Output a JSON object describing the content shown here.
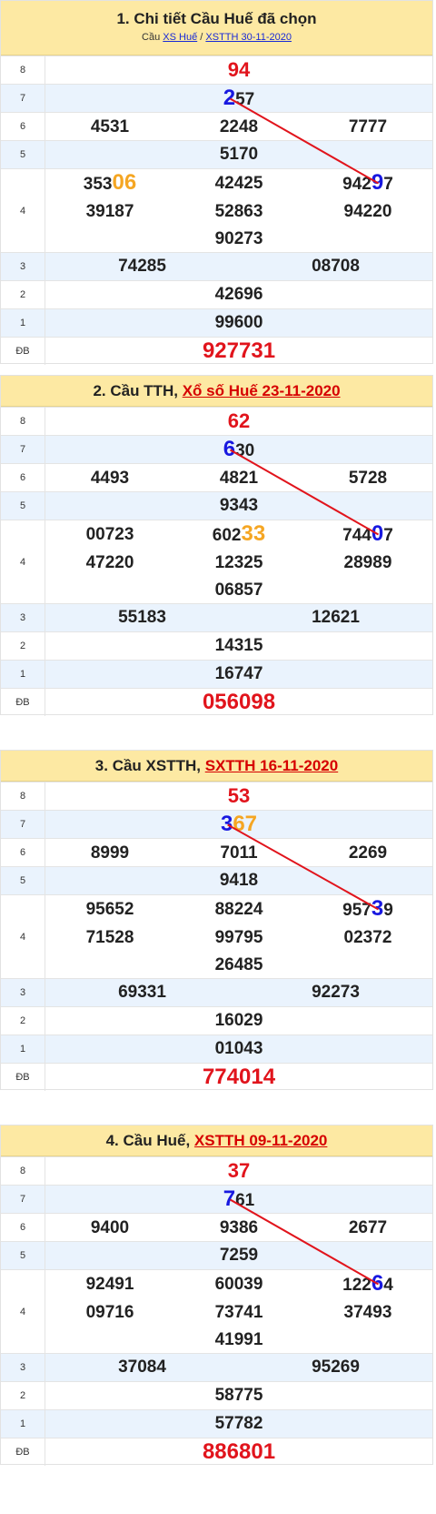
{
  "row_labels": [
    "8",
    "7",
    "6",
    "5",
    "4",
    "3",
    "2",
    "1",
    "ĐB"
  ],
  "blocks": [
    {
      "title": "1. Chi tiết Cầu Huế đã chọn",
      "title_link": "",
      "crumb": {
        "prefix": "Cầu",
        "link1": "XS Huế",
        "sep": "/",
        "link2": "XSTTH 30-11-2020"
      },
      "g8": "94",
      "g7": {
        "pre": "",
        "hl": "2",
        "post": "57",
        "color": "blue"
      },
      "g6": [
        "4531",
        "2248",
        "7777"
      ],
      "g5": "5170",
      "g4": [
        {
          "pre": "353",
          "hl": "06",
          "post": "",
          "color": "orange"
        },
        {
          "pre": "42425",
          "hl": "",
          "post": "",
          "color": ""
        },
        {
          "pre": "942",
          "hl": "9",
          "post": "7",
          "color": "blue"
        },
        {
          "pre": "39187",
          "hl": "",
          "post": "",
          "color": ""
        },
        {
          "pre": "52863",
          "hl": "",
          "post": "",
          "color": ""
        },
        {
          "pre": "94220",
          "hl": "",
          "post": "",
          "color": ""
        },
        {
          "pre": "",
          "hl": "",
          "post": "",
          "color": ""
        },
        {
          "pre": "90273",
          "hl": "",
          "post": "",
          "color": ""
        },
        {
          "pre": "",
          "hl": "",
          "post": "",
          "color": ""
        }
      ],
      "g3": [
        "74285",
        "08708"
      ],
      "g2": "42696",
      "g1": "99600",
      "db": "927731"
    },
    {
      "title": "2. Cầu TTH,",
      "title_link": "Xổ số Huế 23-11-2020",
      "crumb": null,
      "g8": "62",
      "g7": {
        "pre": "",
        "hl": "6",
        "post": "30",
        "color": "blue"
      },
      "g6": [
        "4493",
        "4821",
        "5728"
      ],
      "g5": "9343",
      "g4": [
        {
          "pre": "00723",
          "hl": "",
          "post": "",
          "color": ""
        },
        {
          "pre": "602",
          "hl": "33",
          "post": "",
          "color": "orange"
        },
        {
          "pre": "744",
          "hl": "0",
          "post": "7",
          "color": "blue"
        },
        {
          "pre": "47220",
          "hl": "",
          "post": "",
          "color": ""
        },
        {
          "pre": "12325",
          "hl": "",
          "post": "",
          "color": ""
        },
        {
          "pre": "28989",
          "hl": "",
          "post": "",
          "color": ""
        },
        {
          "pre": "",
          "hl": "",
          "post": "",
          "color": ""
        },
        {
          "pre": "06857",
          "hl": "",
          "post": "",
          "color": ""
        },
        {
          "pre": "",
          "hl": "",
          "post": "",
          "color": ""
        }
      ],
      "g3": [
        "55183",
        "12621"
      ],
      "g2": "14315",
      "g1": "16747",
      "db": "056098"
    },
    {
      "title": "3. Cầu XSTTH,",
      "title_link": "SXTTH 16-11-2020",
      "crumb": null,
      "g8": "53",
      "g7": {
        "pre": "",
        "hl": "3",
        "post": "",
        "color": "blue",
        "hl2": "67"
      },
      "g6": [
        "8999",
        "7011",
        "2269"
      ],
      "g5": "9418",
      "g4": [
        {
          "pre": "95652",
          "hl": "",
          "post": "",
          "color": ""
        },
        {
          "pre": "88224",
          "hl": "",
          "post": "",
          "color": ""
        },
        {
          "pre": "957",
          "hl": "3",
          "post": "9",
          "color": "blue"
        },
        {
          "pre": "71528",
          "hl": "",
          "post": "",
          "color": ""
        },
        {
          "pre": "99795",
          "hl": "",
          "post": "",
          "color": ""
        },
        {
          "pre": "02372",
          "hl": "",
          "post": "",
          "color": ""
        },
        {
          "pre": "",
          "hl": "",
          "post": "",
          "color": ""
        },
        {
          "pre": "26485",
          "hl": "",
          "post": "",
          "color": ""
        },
        {
          "pre": "",
          "hl": "",
          "post": "",
          "color": ""
        }
      ],
      "g3": [
        "69331",
        "92273"
      ],
      "g2": "16029",
      "g1": "01043",
      "db": "774014"
    },
    {
      "title": "4. Cầu Huế,",
      "title_link": "XSTTH 09-11-2020",
      "crumb": null,
      "g8": "37",
      "g7": {
        "pre": "",
        "hl": "7",
        "post": "61",
        "color": "blue"
      },
      "g6": [
        "9400",
        "9386",
        "2677"
      ],
      "g5": "7259",
      "g4": [
        {
          "pre": "92491",
          "hl": "",
          "post": "",
          "color": ""
        },
        {
          "pre": "60039",
          "hl": "",
          "post": "",
          "color": ""
        },
        {
          "pre": "122",
          "hl": "6",
          "post": "4",
          "color": "blue"
        },
        {
          "pre": "09716",
          "hl": "",
          "post": "",
          "color": ""
        },
        {
          "pre": "73741",
          "hl": "",
          "post": "",
          "color": ""
        },
        {
          "pre": "37493",
          "hl": "",
          "post": "",
          "color": ""
        },
        {
          "pre": "",
          "hl": "",
          "post": "",
          "color": ""
        },
        {
          "pre": "41991",
          "hl": "",
          "post": "",
          "color": ""
        },
        {
          "pre": "",
          "hl": "",
          "post": "",
          "color": ""
        }
      ],
      "g3": [
        "37084",
        "95269"
      ],
      "g2": "58775",
      "g1": "57782",
      "db": "886801"
    }
  ],
  "colors": {
    "header_bg": "#fde9a3",
    "alt_row": "#eaf3fd",
    "red": "#e1141c",
    "blue": "#1818e0",
    "orange": "#f5a623",
    "link_blue": "#1a2bd6"
  }
}
